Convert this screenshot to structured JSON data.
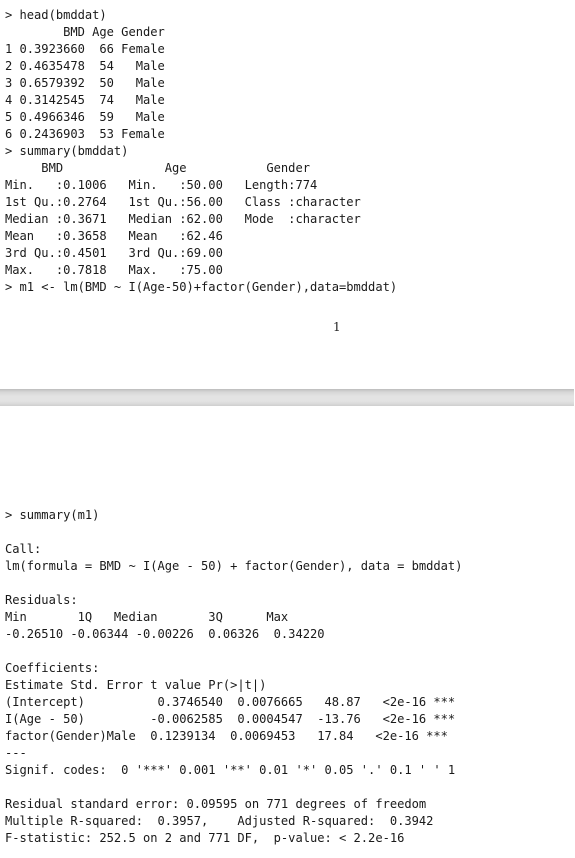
{
  "document": {
    "pages": [
      {
        "page_number": "1",
        "lines": [
          "> head(bmddat)",
          "        BMD Age Gender",
          "1 0.3923660  66 Female",
          "2 0.4635478  54   Male",
          "3 0.6579392  50   Male",
          "4 0.3142545  74   Male",
          "5 0.4966346  59   Male",
          "6 0.2436903  53 Female",
          "> summary(bmddat)",
          "     BMD              Age           Gender         ",
          "Min.   :0.1006   Min.   :50.00   Length:774        ",
          "1st Qu.:0.2764   1st Qu.:56.00   Class :character  ",
          "Median :0.3671   Median :62.00   Mode  :character  ",
          "Mean   :0.3658   Mean   :62.46                     ",
          "3rd Qu.:0.4501   3rd Qu.:69.00                     ",
          "Max.   :0.7818   Max.   :75.00                     ",
          "> m1 <- lm(BMD ~ I(Age-50)+factor(Gender),data=bmddat)"
        ]
      },
      {
        "lines": [
          "> summary(m1)",
          "",
          "Call:",
          "lm(formula = BMD ~ I(Age - 50) + factor(Gender), data = bmddat)",
          "",
          "Residuals:",
          "Min       1Q   Median       3Q      Max",
          "-0.26510 -0.06344 -0.00226  0.06326  0.34220",
          "",
          "Coefficients:",
          "Estimate Std. Error t value Pr(>|t|)",
          "(Intercept)          0.3746540  0.0076665   48.87   <2e-16 ***",
          "I(Age - 50)         -0.0062585  0.0004547  -13.76   <2e-16 ***",
          "factor(Gender)Male  0.1239134  0.0069453   17.84   <2e-16 ***",
          "---",
          "Signif. codes:  0 '***' 0.001 '**' 0.01 '*' 0.05 '.' 0.1 ' ' 1",
          "",
          "Residual standard error: 0.09595 on 771 degrees of freedom",
          "Multiple R-squared:  0.3957,    Adjusted R-squared:  0.3942",
          "F-statistic: 252.5 on 2 and 771 DF,  p-value: < 2.2e-16"
        ]
      }
    ]
  }
}
